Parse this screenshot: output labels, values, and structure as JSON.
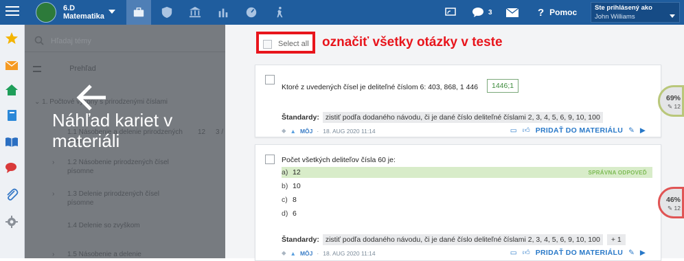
{
  "colors": {
    "topbar": "#1f5d9e",
    "red_callout": "#e8151c",
    "link": "#2878c8",
    "correct": "#d8ecc9"
  },
  "header": {
    "class_name_line1": "6.D",
    "class_name_line2": "Matematika",
    "nav_icons": [
      "briefcase-icon",
      "shield-check-icon",
      "institution-icon",
      "bar-chart-icon",
      "speedometer-icon",
      "running-person-icon"
    ],
    "messages_count": "3",
    "help_label": "Pomoc",
    "user_label": "Ste prihlásený ako",
    "user_name": "John Williams"
  },
  "leftbar": {
    "icons": [
      "star-icon",
      "envelope-icon",
      "home-icon",
      "notebook-icon",
      "open-book-icon",
      "chat-icon",
      "paperclip-icon",
      "gear-icon"
    ]
  },
  "overlay": {
    "search_placeholder": "Hľadaj témy",
    "preview_label": "Prehľad",
    "section": "1. Počtové výkony s prirodzenými číslami",
    "items": [
      {
        "label": "1.1 Násobenie a delenie prirodzených čísel",
        "n1": "12",
        "n2": "3 /"
      },
      {
        "label": "1.2 Násobenie prirodzených čísel písomne",
        "n1": "",
        "n2": ""
      },
      {
        "label": "1.3 Delenie prirodzených čísel písomne",
        "n1": "",
        "n2": ""
      },
      {
        "label": "1.4 Delenie so zvyškom",
        "n1": "",
        "n2": ""
      },
      {
        "label": "1.5 Násobenie a delenie",
        "n1": "",
        "n2": ""
      }
    ],
    "big_title": "Náhľad kariet v materiáli"
  },
  "main": {
    "select_all_label": "Select all",
    "callout": "označiť všetky otázky v teste",
    "standards_label": "Štandardy:",
    "add_to_material": "PRIDAŤ DO MATERIÁLU",
    "questions": [
      {
        "text": "Ktoré z uvedených čísel je deliteľné číslom 6: 403, 868, 1 446",
        "answer": "1446;1",
        "standard": "zistiť podľa dodaného návodu, či je dané číslo deliteľné číslami 2, 3, 4, 5, 6, 9, 10, 100",
        "owner": "MÔJ",
        "date": "18. AUG 2020 11:14",
        "stat_pct": "69%",
        "stat_count": "12",
        "stat_level": 0.69
      },
      {
        "text": "Počet všetkých deliteľov čísla 60 je:",
        "options": [
          {
            "key": "a)",
            "value": "12"
          },
          {
            "key": "b)",
            "value": "10"
          },
          {
            "key": "c)",
            "value": "8"
          },
          {
            "key": "d)",
            "value": "6"
          }
        ],
        "correct_label": "SPRÁVNA ODPOVEĎ",
        "standard": "zistiť podľa dodaného návodu, či je dané číslo deliteľné číslami 2, 3, 4, 5, 6, 9, 10, 100",
        "more_standards": "+ 1",
        "owner": "MÔJ",
        "date": "18. AUG 2020 11:14",
        "stat_pct": "46%",
        "stat_count": "12",
        "stat_level": 0.46
      }
    ]
  }
}
